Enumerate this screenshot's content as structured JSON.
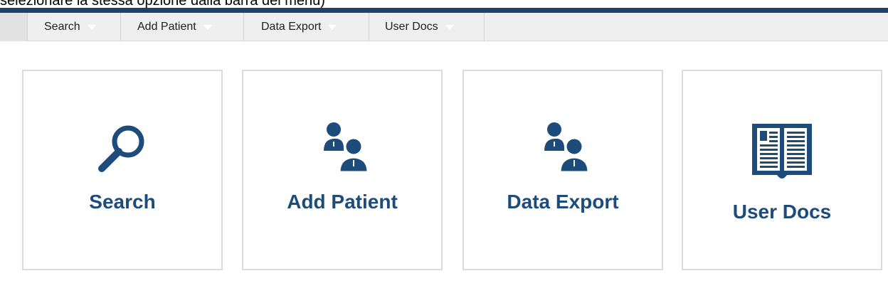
{
  "page": {
    "top_caption": "selezionare la stessa opzione dalla barra dei menu)"
  },
  "menu": {
    "items": [
      {
        "label": "Search"
      },
      {
        "label": "Add Patient"
      },
      {
        "label": "Data Export"
      },
      {
        "label": "User Docs"
      }
    ]
  },
  "tiles": [
    {
      "label": "Search",
      "icon": "search-icon"
    },
    {
      "label": "Add Patient",
      "icon": "users-icon"
    },
    {
      "label": "Data Export",
      "icon": "users-icon"
    },
    {
      "label": "User Docs",
      "icon": "book-icon"
    }
  ],
  "colors": {
    "accent": "#1d4b7a",
    "top_band": "#1f3f6e",
    "menu_bg": "#efefef",
    "tile_border": "#dcdcdc"
  }
}
